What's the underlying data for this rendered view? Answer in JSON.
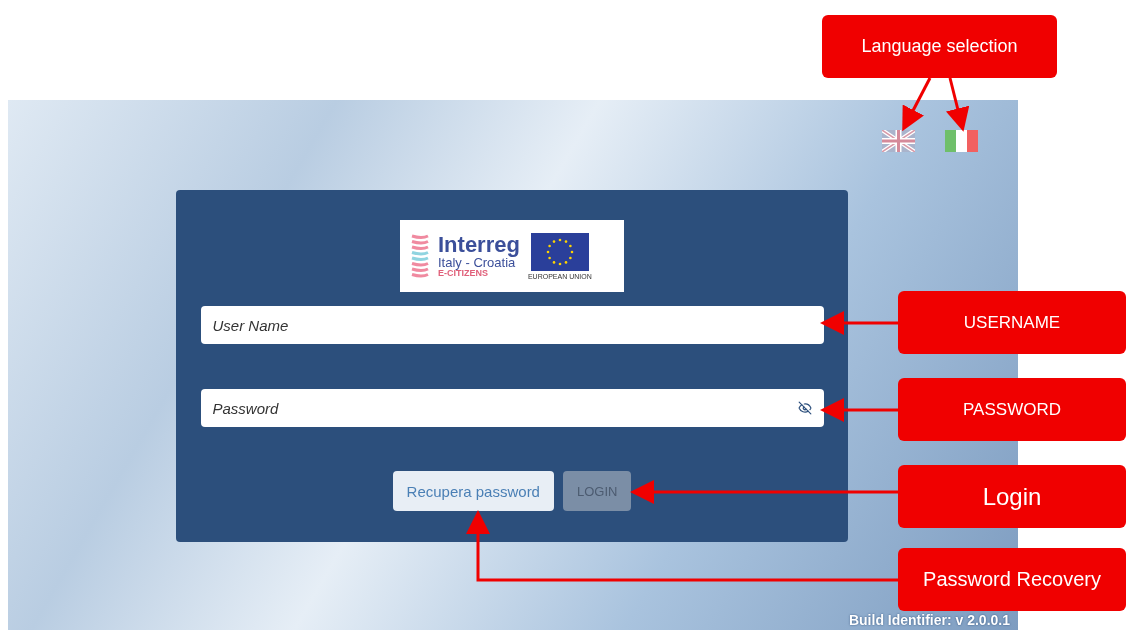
{
  "screen": {
    "language_flags": [
      {
        "kind": "uk"
      },
      {
        "kind": "italy"
      }
    ],
    "logo": {
      "title": "Interreg",
      "subtitle": "Italy - Croatia",
      "project": "E-CITIZENS",
      "eu_caption": "EUROPEAN UNION"
    },
    "username_field": {
      "placeholder": "User Name"
    },
    "password_field": {
      "placeholder": "Password"
    },
    "buttons": [
      {
        "label": "Recupera password",
        "disabled": false
      },
      {
        "label": "LOGIN",
        "disabled": true
      }
    ],
    "build_identifier": "Build Identifier: v 2.0.0.1"
  },
  "annotations": [
    {
      "label": "Language selection"
    },
    {
      "label": "USERNAME"
    },
    {
      "label": "PASSWORD"
    },
    {
      "label": "Login"
    },
    {
      "label": "Password Recovery"
    }
  ]
}
